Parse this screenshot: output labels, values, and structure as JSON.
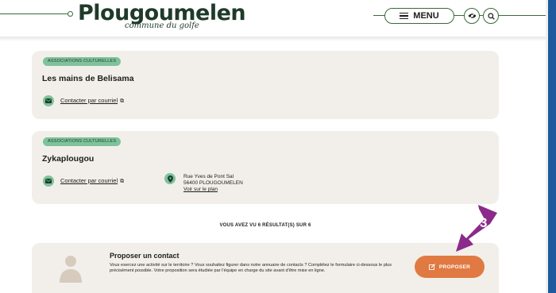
{
  "header": {
    "logo": "Plougoumelen",
    "logo_sub": "commune du golfe",
    "menu_label": "MENU",
    "icons": [
      "menu-icon",
      "eye-icon",
      "search-icon"
    ]
  },
  "cards": [
    {
      "badge": "ASSOCIATIONS CULTURELLES",
      "title": "Les mains de Belisama",
      "mail_link": "Contacter par courriel"
    },
    {
      "badge": "ASSOCIATIONS CULTURELLES",
      "title": "Zykaplougou",
      "mail_link": "Contacter par courriel",
      "address_line1": "Rue Yves de Pont Sal",
      "address_line2": "56400 PLOUGOUMELEN",
      "map_link": "Voir sur le plan"
    }
  ],
  "results_text": "VOUS AVEZ VU 6 RÉSULTAT(S) SUR 6",
  "propose": {
    "title": "Proposer un contact",
    "text": "Vous exercez une activité sur le territoire ? Vous souhaitez figurer dans notre annuaire de contacts ? Complétez le formulaire ci-dessous le plus précisément possible. Votre proposition sera étudiée par l'équipe en charge du site avant d'être mise en ligne.",
    "button_label": "PROPOSER"
  },
  "callout_number": "3",
  "colors": {
    "accent_green": "#7fc29c",
    "dark_green": "#3a6a3a",
    "card_bg": "#f2efea",
    "button_orange": "#e07a42",
    "callout_purple": "#8b2a8b",
    "side_bar_blue": "#1d5a9e"
  }
}
